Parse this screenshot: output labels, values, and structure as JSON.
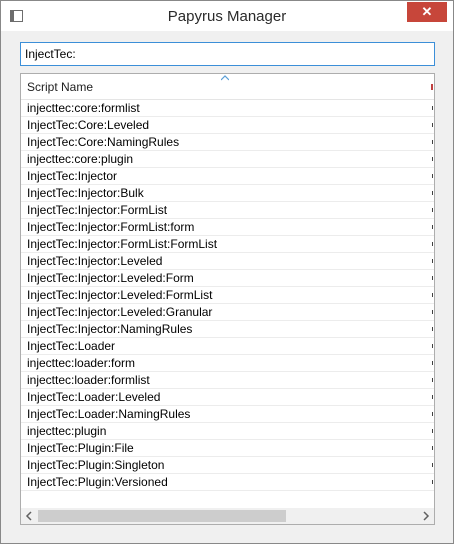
{
  "window": {
    "title": "Papyrus Manager",
    "close_glyph": "✕"
  },
  "search": {
    "value": "InjectTec:"
  },
  "table": {
    "column_header": "Script Name",
    "sort_direction": "ascending",
    "rows": [
      "injecttec:core:formlist",
      "InjectTec:Core:Leveled",
      "InjectTec:Core:NamingRules",
      "injecttec:core:plugin",
      "InjectTec:Injector",
      "InjectTec:Injector:Bulk",
      "InjectTec:Injector:FormList",
      "InjectTec:Injector:FormList:form",
      "InjectTec:Injector:FormList:FormList",
      "InjectTec:Injector:Leveled",
      "InjectTec:Injector:Leveled:Form",
      "InjectTec:Injector:Leveled:FormList",
      "InjectTec:Injector:Leveled:Granular",
      "InjectTec:Injector:NamingRules",
      "InjectTec:Loader",
      "injecttec:loader:form",
      "injecttec:loader:formlist",
      "InjectTec:Loader:Leveled",
      "InjectTec:Loader:NamingRules",
      "injecttec:plugin",
      "InjectTec:Plugin:File",
      "InjectTec:Plugin:Singleton",
      "InjectTec:Plugin:Versioned"
    ]
  },
  "icons": {
    "app": "app-window-icon",
    "close": "close-icon",
    "sort": "sort-ascending-icon",
    "scroll_left": "chevron-left-icon",
    "scroll_right": "chevron-right-icon"
  },
  "colors": {
    "close_button": "#c7463a",
    "input_focus_border": "#3c8fd8",
    "sort_arrow": "#5a9fd6"
  }
}
